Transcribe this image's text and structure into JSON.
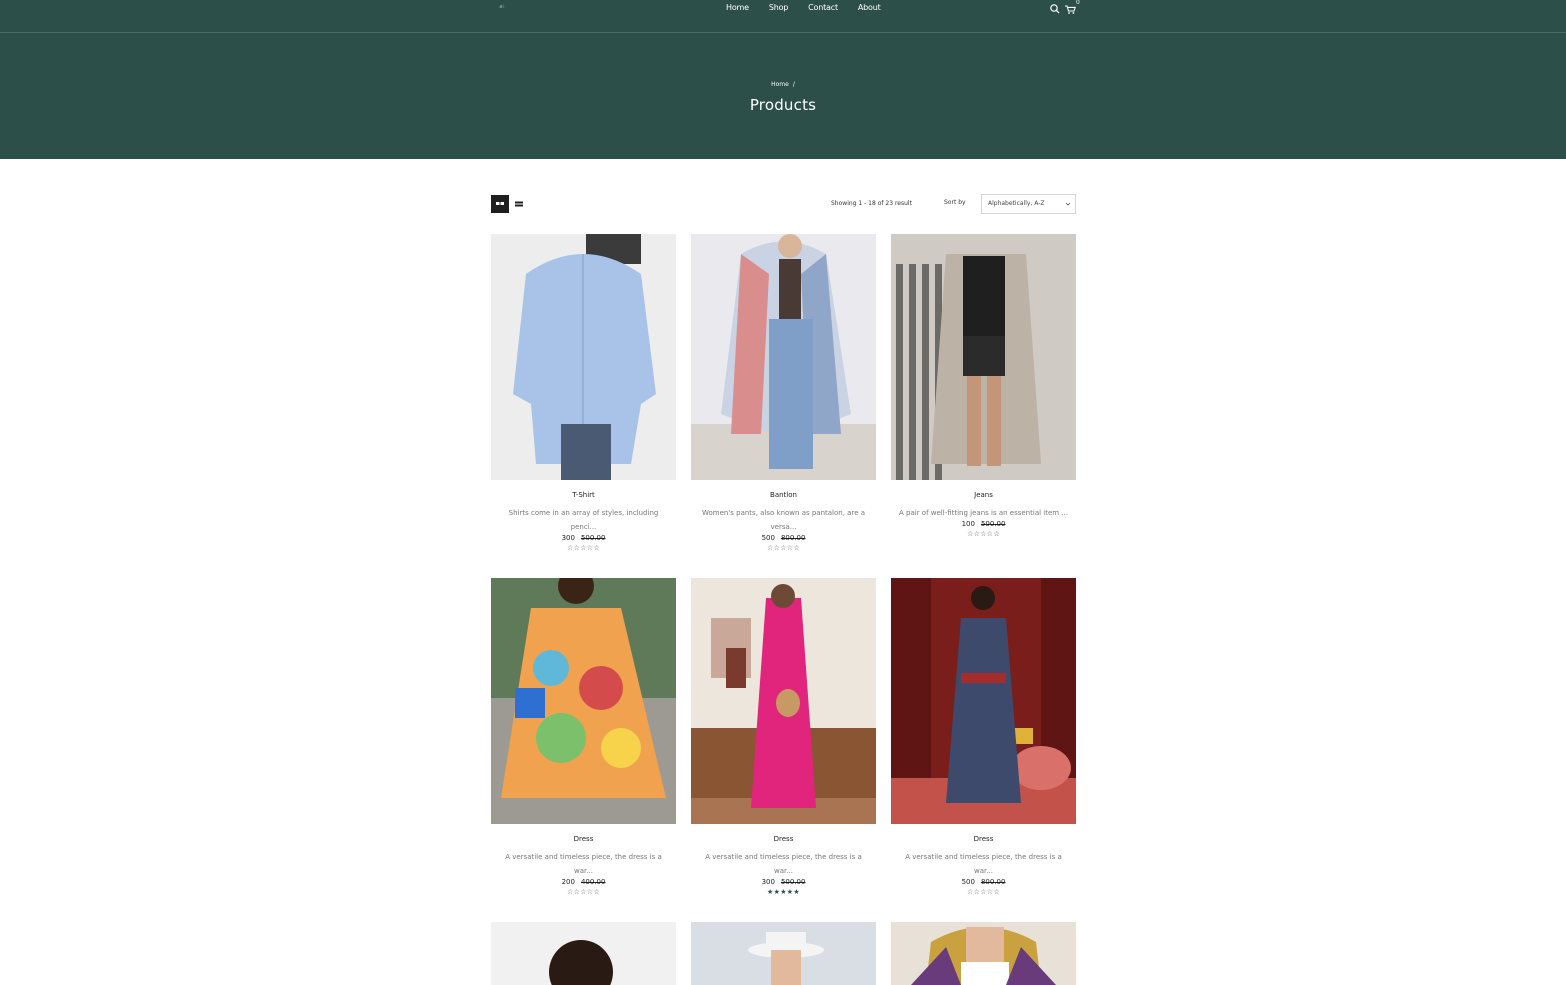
{
  "header": {
    "nav": [
      "Home",
      "Shop",
      "Contact",
      "About"
    ],
    "cart_count": "0",
    "icons": [
      "search-icon",
      "cart-icon"
    ]
  },
  "hero": {
    "breadcrumb_home": "Home",
    "breadcrumb_sep": "/",
    "title": "Products"
  },
  "toolbar": {
    "result_text": "Showing 1 - 18 of 23 result",
    "sort_label": "Sort by",
    "sort_value": "Alphabetically, A-Z",
    "view_icons": [
      "grid-view-icon",
      "list-view-icon"
    ]
  },
  "products": [
    {
      "name": "T-Shirt",
      "desc": "Shirts come in an array of styles, including penci...",
      "price": "300",
      "old_price": "500.00",
      "rating": 0
    },
    {
      "name": "Bantlon",
      "desc": "Women's pants, also known as pantalon, are a versa...",
      "price": "500",
      "old_price": "800.00",
      "rating": 0
    },
    {
      "name": "Jeans",
      "desc": "A pair of well-fitting jeans is an essential item ...",
      "price": "100",
      "old_price": "500.00",
      "rating": 0
    },
    {
      "name": "Dress",
      "desc": "A versatile and timeless piece, the dress is a war...",
      "price": "200",
      "old_price": "400.00",
      "rating": 0
    },
    {
      "name": "Dress",
      "desc": "A versatile and timeless piece, the dress is a war...",
      "price": "300",
      "old_price": "500.00",
      "rating": 5
    },
    {
      "name": "Dress",
      "desc": "A versatile and timeless piece, the dress is a war...",
      "price": "500",
      "old_price": "800.00",
      "rating": 0
    }
  ],
  "colors": {
    "hero_bg": "#2d4f49",
    "accent": "#2d4f49"
  }
}
